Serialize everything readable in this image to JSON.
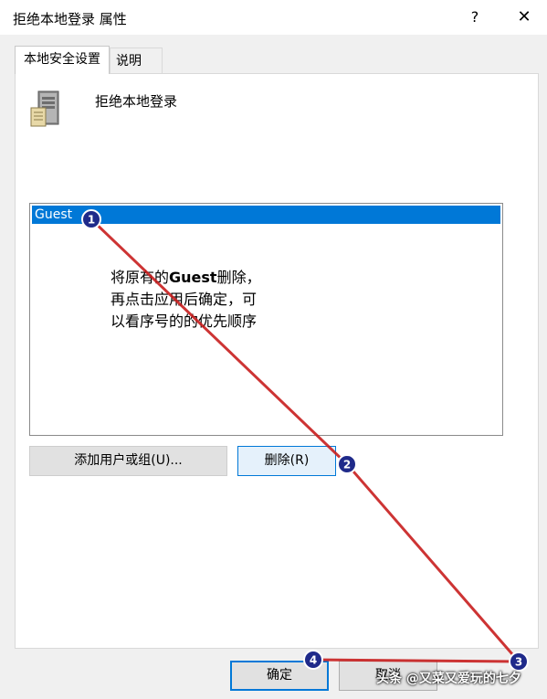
{
  "window": {
    "title": "拒绝本地登录 属性",
    "help_label": "?",
    "close_label": "✕"
  },
  "tabs": [
    {
      "label": "本地安全设置"
    },
    {
      "label": "说明"
    }
  ],
  "policy": {
    "icon": "server-icon",
    "name": "拒绝本地登录"
  },
  "list": {
    "items": [
      {
        "label": "Guest",
        "selected": true
      }
    ]
  },
  "annotation": {
    "line1_prefix": "将原有的",
    "line1_bold": "Guest",
    "line1_suffix": "删除，",
    "line2": "再点击应用后确定，可",
    "line3": "以看序号的的优先顺序"
  },
  "buttons": {
    "add": "添加用户或组(U)...",
    "remove": "删除(R)",
    "ok": "确定",
    "cancel": "取消"
  },
  "markers": [
    "1",
    "2",
    "3",
    "4"
  ],
  "colors": {
    "accent": "#0078d7",
    "annotation_line": "#c81e1e",
    "marker_fill": "#1f2a8a"
  },
  "watermark": "头条 @又菜又爱玩的七夕"
}
